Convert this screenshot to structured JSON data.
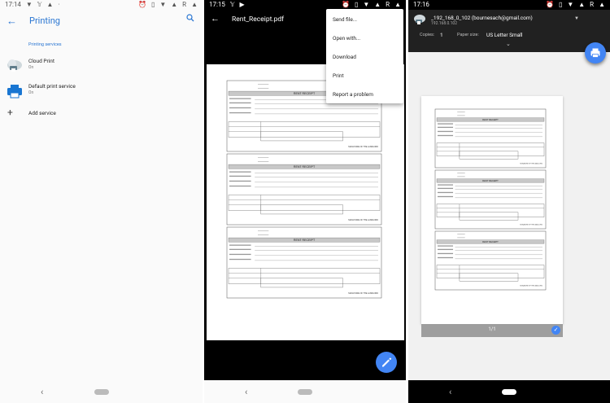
{
  "settings_screen": {
    "status_time": "17:14",
    "title": "Printing",
    "section_header": "Printing services",
    "services": [
      {
        "name": "Cloud Print",
        "status": "On",
        "icon": "cloud-print-icon"
      },
      {
        "name": "Default print service",
        "status": "On",
        "icon": "printer-icon"
      },
      {
        "name": "Add service",
        "status": "",
        "icon": "plus-icon"
      }
    ]
  },
  "pdf_viewer_screen": {
    "status_time": "17:15",
    "file_name": "Rent_Receipt.pdf",
    "menu_items": [
      "Send file...",
      "Open with...",
      "Download",
      "Print",
      "Report a problem"
    ],
    "fab_icon": "pencil-icon"
  },
  "print_preview_screen": {
    "status_time": "17:16",
    "printer_name": "_192_168_0_102 (bournesach@gmail.com)",
    "printer_ip": "192.168.0.102",
    "copies_label": "Copies:",
    "copies_value": "1",
    "paper_size_label": "Paper size:",
    "paper_size_value": "US Letter Small",
    "page_counter": "1/1",
    "fab_icon": "print-icon"
  },
  "receipt": {
    "heading": "RENT RECEIPT",
    "signature_label": "SIGNATURE OF THE LANDLORD"
  },
  "colors": {
    "accent": "#2a76d2",
    "fab": "#4285f4",
    "dark_header": "#212121"
  }
}
